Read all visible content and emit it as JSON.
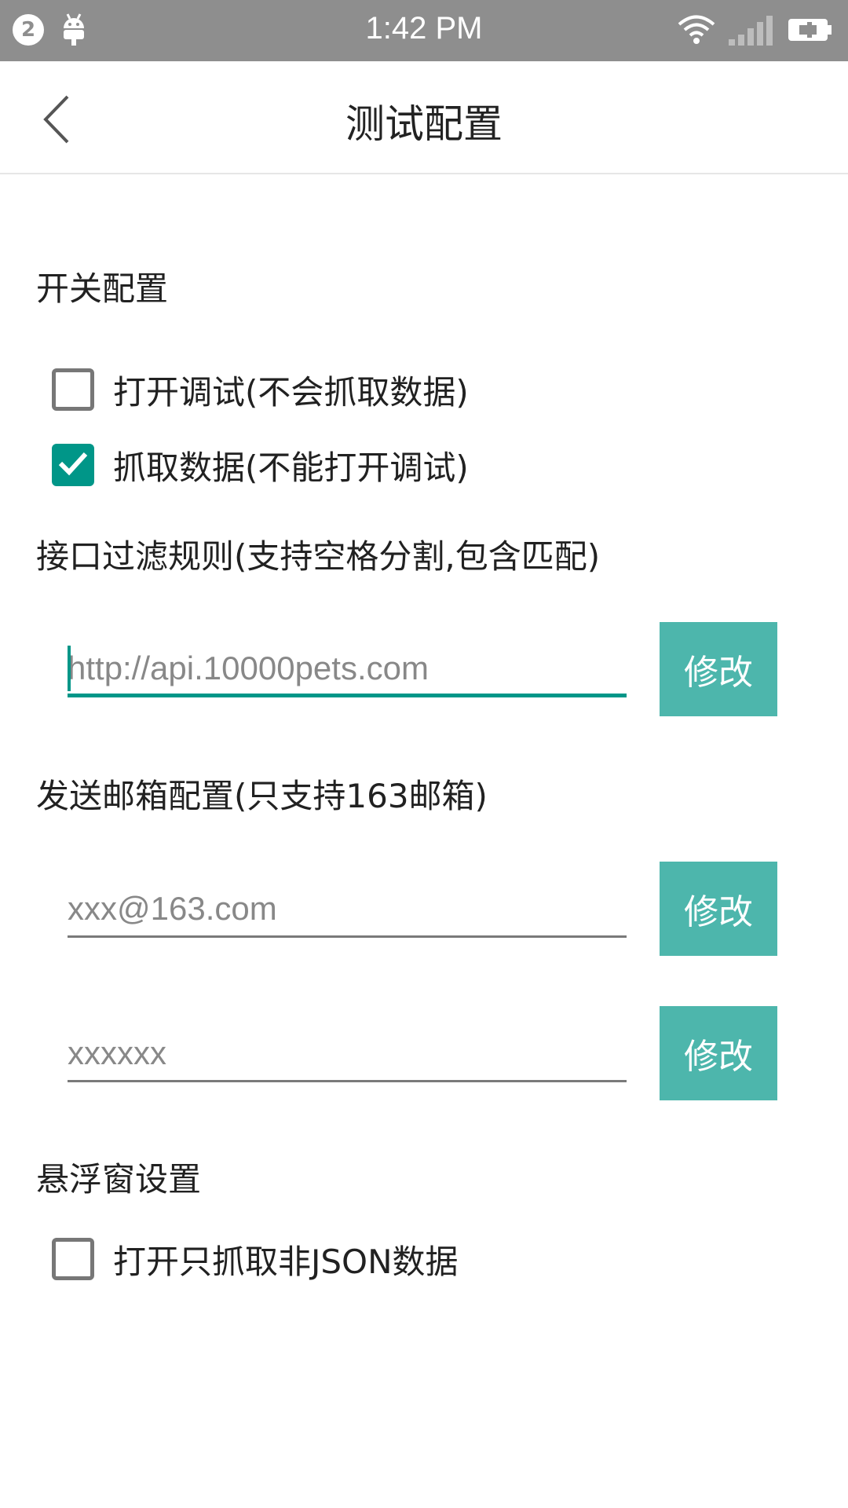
{
  "status_bar": {
    "notification_count": "2",
    "time": "1:42 PM"
  },
  "toolbar": {
    "title": "测试配置",
    "back_icon": "chevron-left-icon"
  },
  "switch_section": {
    "label": "开关配置",
    "options": [
      {
        "label": "打开调试(不会抓取数据)",
        "checked": false
      },
      {
        "label": "抓取数据(不能打开调试)",
        "checked": true
      }
    ]
  },
  "filter_section": {
    "label": "接口过滤规则(支持空格分割,包含匹配)",
    "input_placeholder": "http://api.10000pets.com",
    "button_label": "修改"
  },
  "email_section": {
    "label": "发送邮箱配置(只支持163邮箱)",
    "email_placeholder": "xxx@163.com",
    "email_button_label": "修改",
    "password_placeholder": "xxxxxx",
    "password_button_label": "修改"
  },
  "float_section": {
    "label": "悬浮窗设置",
    "option": {
      "label": "打开只抓取非JSON数据",
      "checked": false
    }
  },
  "colors": {
    "accent": "#009688",
    "button": "#4db6ac",
    "status_bar": "#8e8e8e"
  }
}
